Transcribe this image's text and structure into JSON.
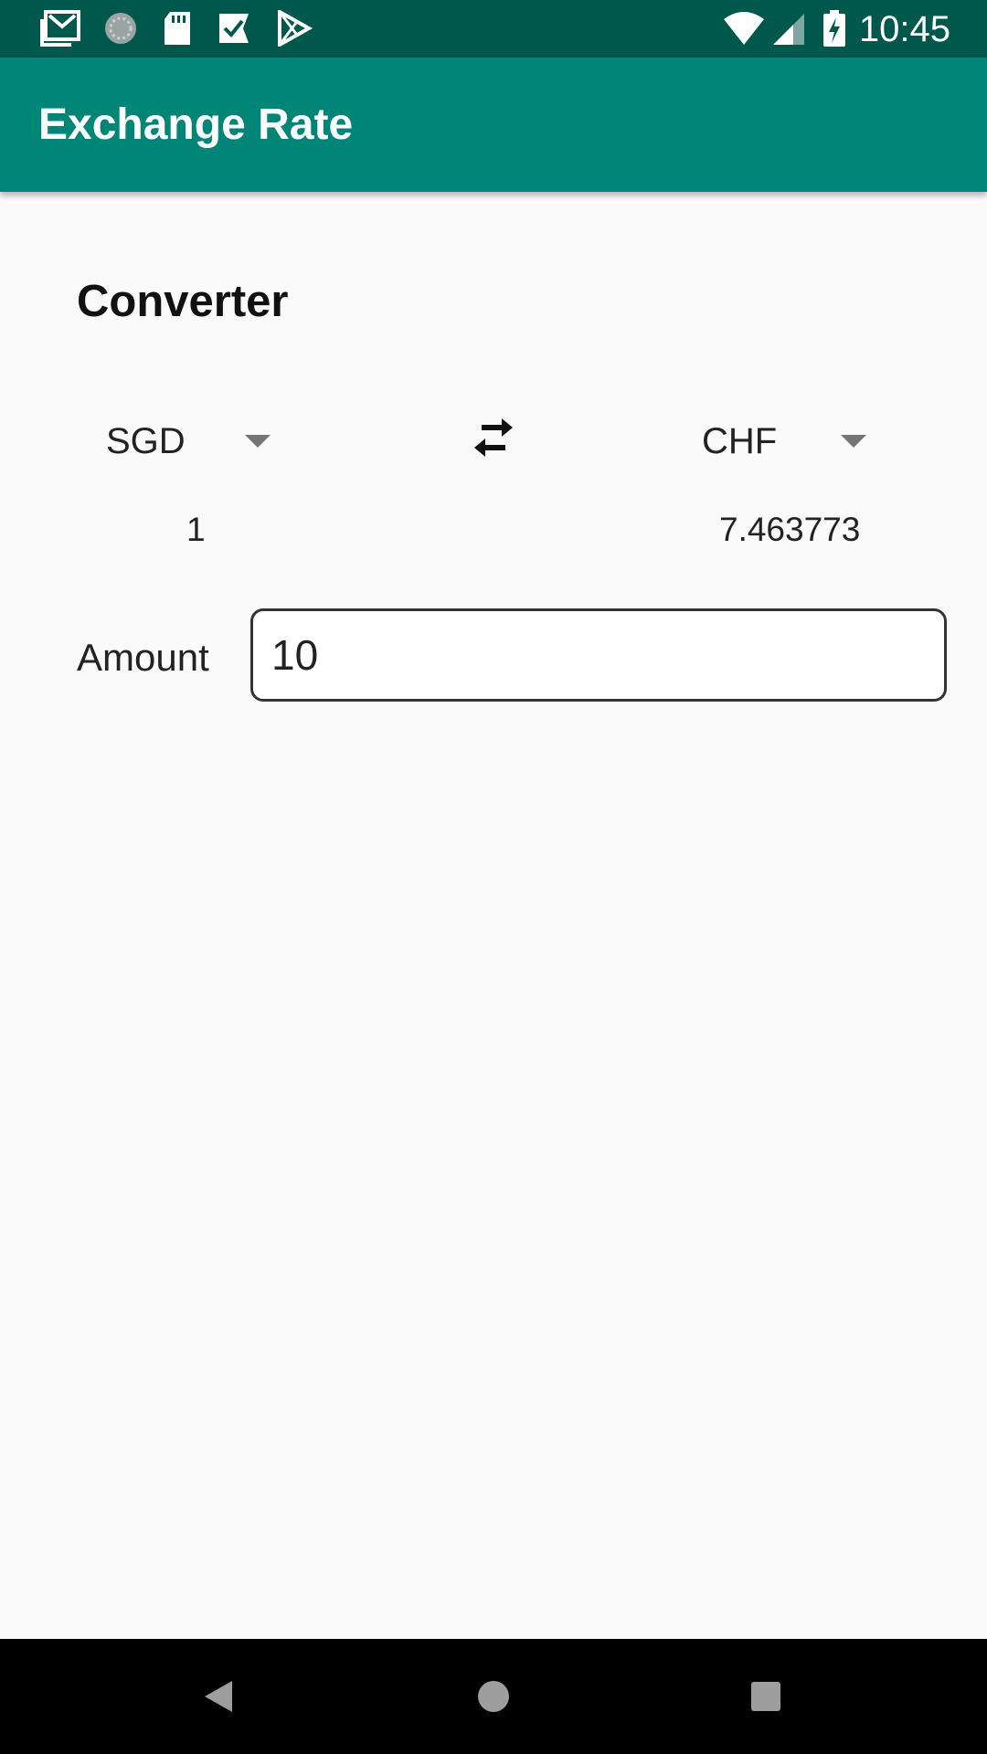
{
  "status_bar": {
    "time": "10:45",
    "left_icons": [
      "gmail-icon",
      "loading-icon",
      "sd-card-icon",
      "task-check-icon",
      "play-store-icon"
    ],
    "right_icons": [
      "wifi-icon",
      "cellular-signal-icon",
      "battery-charging-icon"
    ]
  },
  "app_bar": {
    "title": "Exchange Rate",
    "color": "#008577"
  },
  "converter": {
    "title": "Converter",
    "from_currency": "SGD",
    "to_currency": "CHF",
    "from_value": "1",
    "to_value": "7.463773",
    "swap_icon": "swap-horiz-icon"
  },
  "amount": {
    "label": "Amount",
    "value": "10"
  },
  "nav_bar": {
    "buttons": [
      "back-icon",
      "home-icon",
      "recents-icon"
    ]
  }
}
